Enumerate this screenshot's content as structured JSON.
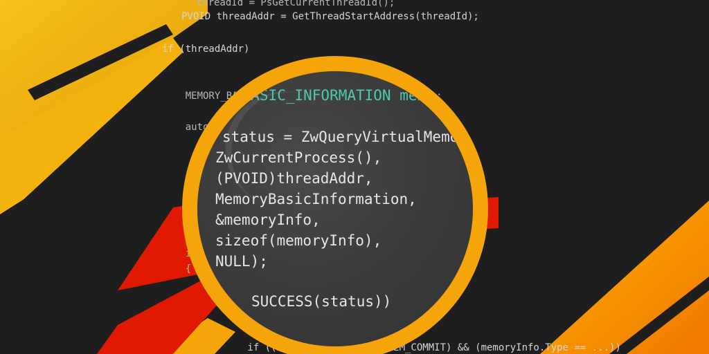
{
  "background_code": {
    "lines": [
      "    threadId = PsGetCurrentThreadId();",
      "PVOID threadAddr = GetThreadStartAddress(threadId);",
      "if (threadAddr)",
      "    MEMORY_BASIC_INFORMATION memoryInfo = { 0 };",
      "    auto status = ZwQueryVirtualMemory(",
      "    i",
      "    {",
      "        if ((memoryInfo.State & MEM_COMMIT) && (memoryInfo.Type == ...))"
    ]
  },
  "magnified_code": {
    "lines": [
      "_BASIC_INFORMATION mem",
      "status = ZwQueryVirtualMemo",
      "ZwCurrentProcess(),",
      "(PVOID)threadAddr,",
      "MemoryBasicInformation,",
      "&memoryInfo,",
      "sizeof(memoryInfo),",
      "NULL);",
      "SUCCESS(status))"
    ]
  },
  "colors": {
    "background": "#1e1e1e",
    "accent_orange": "#f5a50a",
    "accent_red": "#e01a00",
    "accent_yellow": "#f4b400",
    "keyword_blue": "#569cd6",
    "type_teal": "#4ec9b0"
  }
}
